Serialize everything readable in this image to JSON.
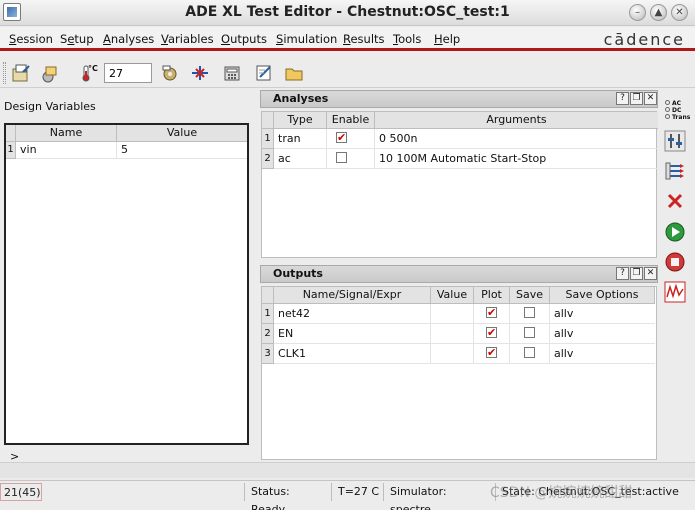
{
  "window": {
    "title": "ADE XL Test Editor - Chestnut:OSC_test:1"
  },
  "menu": {
    "items": [
      {
        "label": "Session",
        "u": "S",
        "rest": "ession"
      },
      {
        "label": "Setup",
        "u": "e",
        "pre": "S",
        "rest": "tup"
      },
      {
        "label": "Analyses",
        "u": "A",
        "rest": "nalyses"
      },
      {
        "label": "Variables",
        "u": "V",
        "rest": "ariables"
      },
      {
        "label": "Outputs",
        "u": "O",
        "rest": "utputs"
      },
      {
        "label": "Simulation",
        "u": "S",
        "rest": "imulation"
      },
      {
        "label": "Results",
        "u": "R",
        "rest": "esults"
      },
      {
        "label": "Tools",
        "u": "T",
        "rest": "ools"
      },
      {
        "label": "Help",
        "u": "H",
        "rest": "elp"
      }
    ],
    "brand": "cādence"
  },
  "toolbar": {
    "temperature_unit": "°C",
    "temperature_value": "27"
  },
  "design_variables": {
    "title": "Design Variables",
    "columns": [
      "Name",
      "Value"
    ],
    "rows": [
      {
        "num": "1",
        "name": "vin",
        "value": "5"
      }
    ],
    "expander": ">"
  },
  "analyses": {
    "title": "Analyses",
    "columns": [
      "Type",
      "Enable",
      "Arguments"
    ],
    "rows": [
      {
        "num": "1",
        "type": "tran",
        "enable": true,
        "arguments": "0 500n"
      },
      {
        "num": "2",
        "type": "ac",
        "enable": false,
        "arguments": "10 100M Automatic Start-Stop"
      }
    ]
  },
  "outputs": {
    "title": "Outputs",
    "columns": [
      "Name/Signal/Expr",
      "Value",
      "Plot",
      "Save",
      "Save Options"
    ],
    "rows": [
      {
        "num": "1",
        "name": "net42",
        "value": "",
        "plot": true,
        "save": false,
        "save_options": "allv"
      },
      {
        "num": "2",
        "name": "EN",
        "value": "",
        "plot": true,
        "save": false,
        "save_options": "allv"
      },
      {
        "num": "3",
        "name": "CLK1",
        "value": "",
        "plot": true,
        "save": false,
        "save_options": "allv"
      }
    ]
  },
  "side_toolbar": {
    "analysis_labels": [
      "AC",
      "DC",
      "Trans"
    ]
  },
  "status": {
    "counter": "21(45)",
    "state": "Status: Ready",
    "temperature": "T=27 C",
    "simulator": "Simulator: spectre",
    "state_info": "State: Chestnut:OSC_test:active"
  },
  "watermark": "CSDN @婉婉婉婉甜甜"
}
